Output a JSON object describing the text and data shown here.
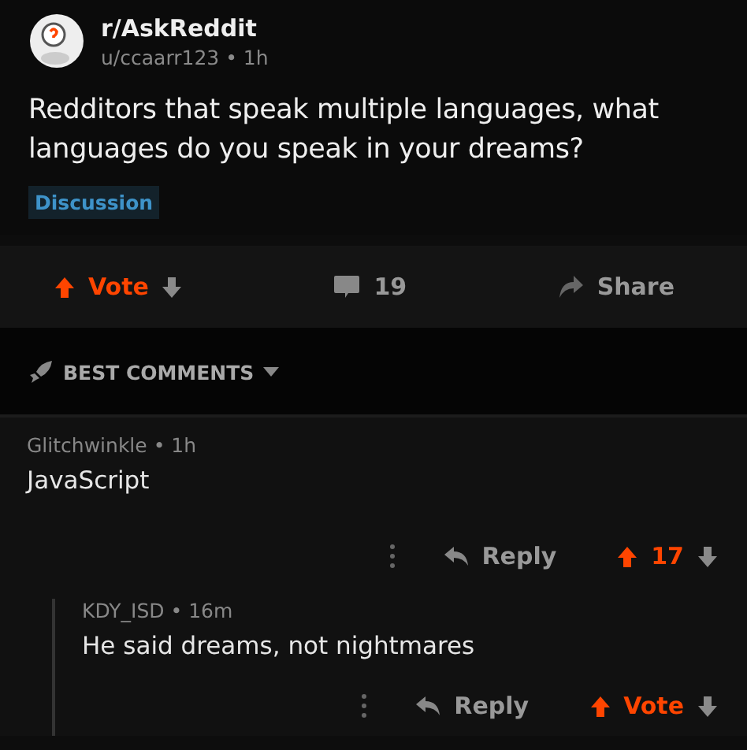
{
  "post": {
    "subreddit": "r/AskReddit",
    "meta": "u/ccaarr123 • 1h",
    "title": "Redditors that speak multiple languages, what languages do you speak in your dreams?",
    "flair": "Discussion"
  },
  "actions": {
    "vote_label": "Vote",
    "upvoted": true,
    "comments": "19",
    "share": "Share"
  },
  "sort": {
    "label": "BEST COMMENTS"
  },
  "comments": [
    {
      "meta": "Glitchwinkle • 1h",
      "text": "JavaScript",
      "reply": "Reply",
      "score": "17",
      "upvoted": true,
      "children": [
        {
          "meta": "KDY_ISD • 16m",
          "text": "He said dreams, not nightmares",
          "reply": "Reply",
          "score": "Vote",
          "upvoted": true
        }
      ]
    }
  ]
}
